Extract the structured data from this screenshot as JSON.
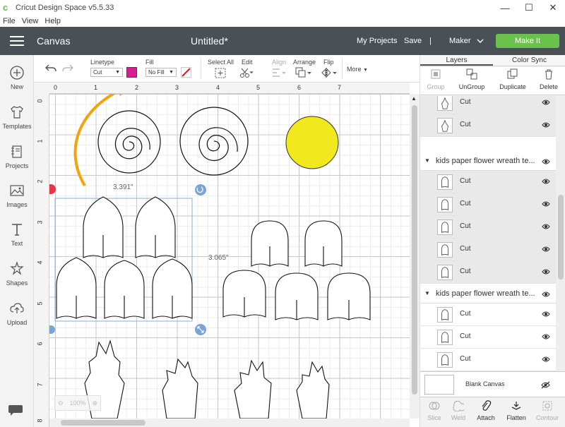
{
  "app": {
    "title": "Cricut Design Space  v5.5.33"
  },
  "window_controls": {
    "minimize": "—",
    "maximize": "☐",
    "close": "✕"
  },
  "menu": [
    "File",
    "View",
    "Help"
  ],
  "header": {
    "section": "Canvas",
    "document_title": "Untitled*",
    "my_projects": "My Projects",
    "save": "Save",
    "separator": "|",
    "machine": "Maker",
    "make_it": "Make It"
  },
  "sidebar": [
    {
      "label": "New",
      "icon": "plus-circle-icon"
    },
    {
      "label": "Templates",
      "icon": "shirt-icon"
    },
    {
      "label": "Projects",
      "icon": "notebook-icon"
    },
    {
      "label": "Images",
      "icon": "image-icon"
    },
    {
      "label": "Text",
      "icon": "text-icon"
    },
    {
      "label": "Shapes",
      "icon": "shapes-icon"
    },
    {
      "label": "Upload",
      "icon": "cloud-upload-icon"
    }
  ],
  "toolbar": {
    "linetype_label": "Linetype",
    "linetype_value": "Cut",
    "fill_label": "Fill",
    "fill_value": "No Fill",
    "select_all": "Select All",
    "edit": "Edit",
    "align": "Align",
    "arrange": "Arrange",
    "flip": "Flip",
    "more": "More",
    "swatch_color": "#d61f8c"
  },
  "ruler": {
    "x": [
      "0",
      "1",
      "2",
      "3",
      "4",
      "5",
      "6",
      "7"
    ],
    "y": [
      "0",
      "1",
      "2",
      "3",
      "4",
      "5",
      "6",
      "7",
      "8"
    ]
  },
  "canvas": {
    "width_dim": "3.391\"",
    "height_dim": "3.065\"",
    "circle_color": "#f2e81e",
    "arrow_color": "#f5a30a",
    "zoom": "100%"
  },
  "panel": {
    "tabs": [
      "Layers",
      "Color Sync"
    ],
    "actions": {
      "group": "Group",
      "ungroup": "UnGroup",
      "duplicate": "Duplicate",
      "delete": "Delete"
    },
    "group_name": "kids paper flower wreath te...",
    "layer_label": "Cut",
    "blank_canvas": "Blank Canvas",
    "bottom": {
      "slice": "Slice",
      "weld": "Weld",
      "attach": "Attach",
      "flatten": "Flatten",
      "contour": "Contour"
    }
  }
}
